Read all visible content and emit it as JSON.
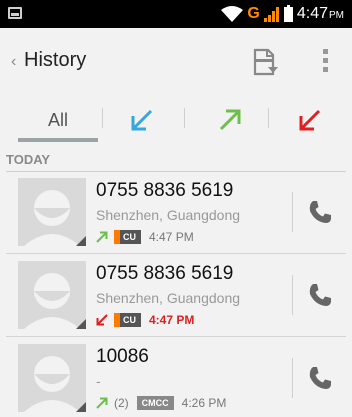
{
  "status_bar": {
    "network": "G",
    "time": "4:47",
    "ampm": "PM"
  },
  "action_bar": {
    "back_chevron": "‹",
    "title": "History",
    "export_icon": "export-contacts-icon",
    "menu_icon": "overflow-menu-icon"
  },
  "tabs": [
    {
      "label": "All",
      "icon": "",
      "selected": true
    },
    {
      "label": "",
      "icon": "incoming-call-icon",
      "color": "#33a8e0"
    },
    {
      "label": "",
      "icon": "outgoing-call-icon",
      "color": "#6cc04a"
    },
    {
      "label": "",
      "icon": "missed-call-icon",
      "color": "#e02020"
    }
  ],
  "section": {
    "label": "TODAY"
  },
  "calls": [
    {
      "number": "0755 8836 5619",
      "location": "Shenzhen, Guangdong",
      "type": "outgoing",
      "type_icon": "outgoing-call-icon",
      "count": "",
      "carrier": "CU",
      "time": "4:47 PM",
      "missed": false
    },
    {
      "number": "0755 8836 5619",
      "location": "Shenzhen, Guangdong",
      "type": "missed",
      "type_icon": "missed-call-icon",
      "count": "",
      "carrier": "CU",
      "time": "4:47 PM",
      "missed": true
    },
    {
      "number": "10086",
      "location": "-",
      "type": "outgoing",
      "type_icon": "outgoing-call-icon",
      "count": "(2)",
      "carrier": "CMCC",
      "time": "4:26 PM",
      "missed": false
    }
  ],
  "colors": {
    "incoming": "#33a8e0",
    "outgoing": "#6cc04a",
    "missed": "#e02020",
    "carrier_accent": "#ff7a00"
  }
}
